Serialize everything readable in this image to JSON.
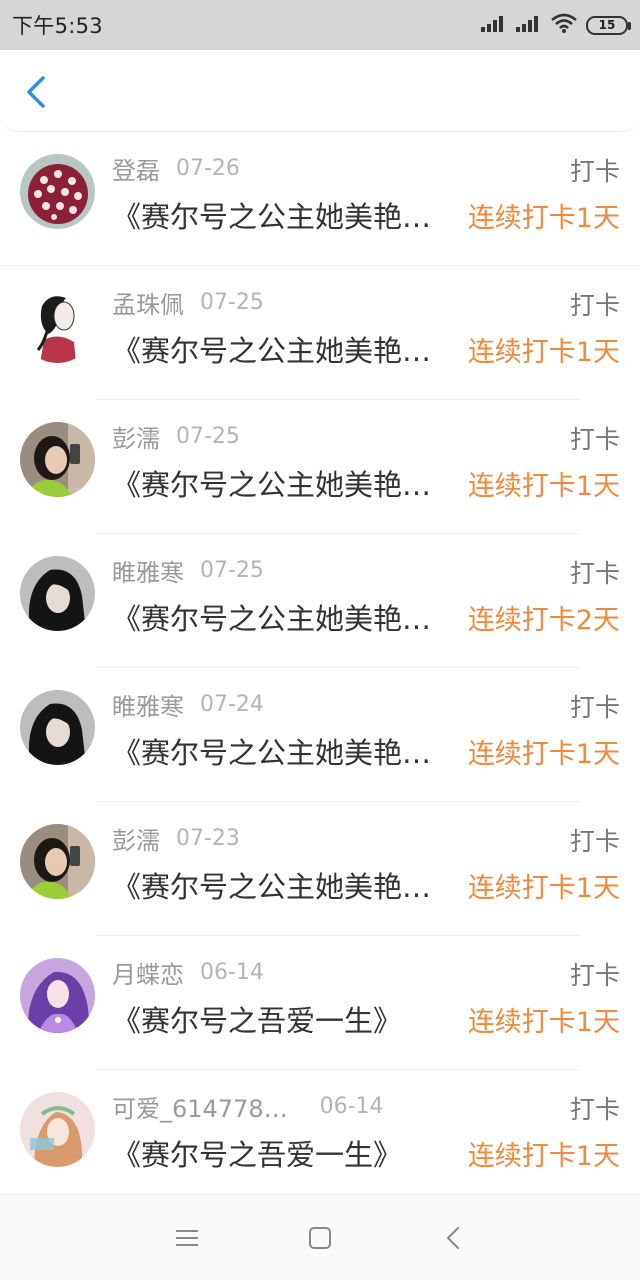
{
  "status_bar": {
    "time": "下午5:53",
    "battery": "15",
    "icons": [
      "signal-icon",
      "signal-icon",
      "wifi-icon",
      "battery-icon"
    ]
  },
  "header": {
    "back_icon": "chevron-left-icon"
  },
  "colors": {
    "accent": "#2f8ee8",
    "streak": "#f08a3c",
    "muted": "#9a9a9a"
  },
  "items": [
    {
      "user": "登磊",
      "date": "07-26",
      "action": "打卡",
      "title": "《赛尔号之公主她美艳…",
      "streak": "连续打卡1天"
    },
    {
      "user": "孟珠佩",
      "date": "07-25",
      "action": "打卡",
      "title": "《赛尔号之公主她美艳…",
      "streak": "连续打卡1天"
    },
    {
      "user": "彭濡",
      "date": "07-25",
      "action": "打卡",
      "title": "《赛尔号之公主她美艳…",
      "streak": "连续打卡1天"
    },
    {
      "user": "睢雅寒",
      "date": "07-25",
      "action": "打卡",
      "title": "《赛尔号之公主她美艳…",
      "streak": "连续打卡2天"
    },
    {
      "user": "睢雅寒",
      "date": "07-24",
      "action": "打卡",
      "title": "《赛尔号之公主她美艳…",
      "streak": "连续打卡1天"
    },
    {
      "user": "彭濡",
      "date": "07-23",
      "action": "打卡",
      "title": "《赛尔号之公主她美艳…",
      "streak": "连续打卡1天"
    },
    {
      "user": "月蝶恋",
      "date": "06-14",
      "action": "打卡",
      "title": "《赛尔号之吾爱一生》",
      "streak": "连续打卡1天"
    },
    {
      "user": "可爱_614778…",
      "date": "06-14",
      "action": "打卡",
      "title": "《赛尔号之吾爱一生》",
      "streak": "连续打卡1天"
    }
  ],
  "nav_bar": {
    "icons": [
      "menu-icon",
      "home-square-icon",
      "back-triangle-icon"
    ]
  }
}
